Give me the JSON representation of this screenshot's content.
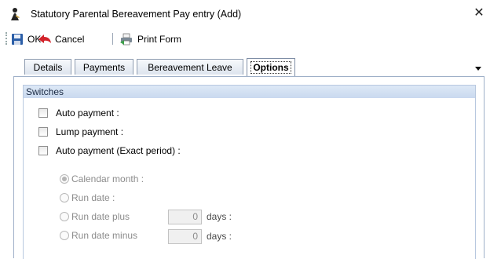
{
  "window": {
    "title": "Statutory Parental Bereavement Pay entry (Add)",
    "close_symbol": "✕",
    "app_icon": "person-icon"
  },
  "toolbar": {
    "ok_label": "OK",
    "cancel_label": "Cancel",
    "print_label": "Print Form",
    "icons": [
      "save-icon",
      "back-arrow-icon",
      "print-form-icon"
    ]
  },
  "tabs": [
    {
      "label": "Details",
      "active": false
    },
    {
      "label": "Payments",
      "active": false
    },
    {
      "label": "Bereavement Leave",
      "active": false
    },
    {
      "label": "Options",
      "active": true
    }
  ],
  "switches": {
    "header": "Switches",
    "checkboxes": [
      {
        "label": "Auto payment :",
        "checked": false
      },
      {
        "label": "Lump payment :",
        "checked": false
      },
      {
        "label": "Auto payment (Exact period) :",
        "checked": false
      }
    ],
    "radios": [
      {
        "label": "Calendar month :",
        "selected": true,
        "enabled": false
      },
      {
        "label": "Run date :",
        "selected": false,
        "enabled": false
      },
      {
        "label": "Run date plus",
        "selected": false,
        "enabled": false,
        "value": "0",
        "unit": "days :"
      },
      {
        "label": "Run date minus",
        "selected": false,
        "enabled": false,
        "value": "0",
        "unit": "days :"
      }
    ]
  },
  "colors": {
    "group_header": "#c9d9ef",
    "disabled_text": "#8c8c8c",
    "cancel_arrow": "#d2232a"
  }
}
